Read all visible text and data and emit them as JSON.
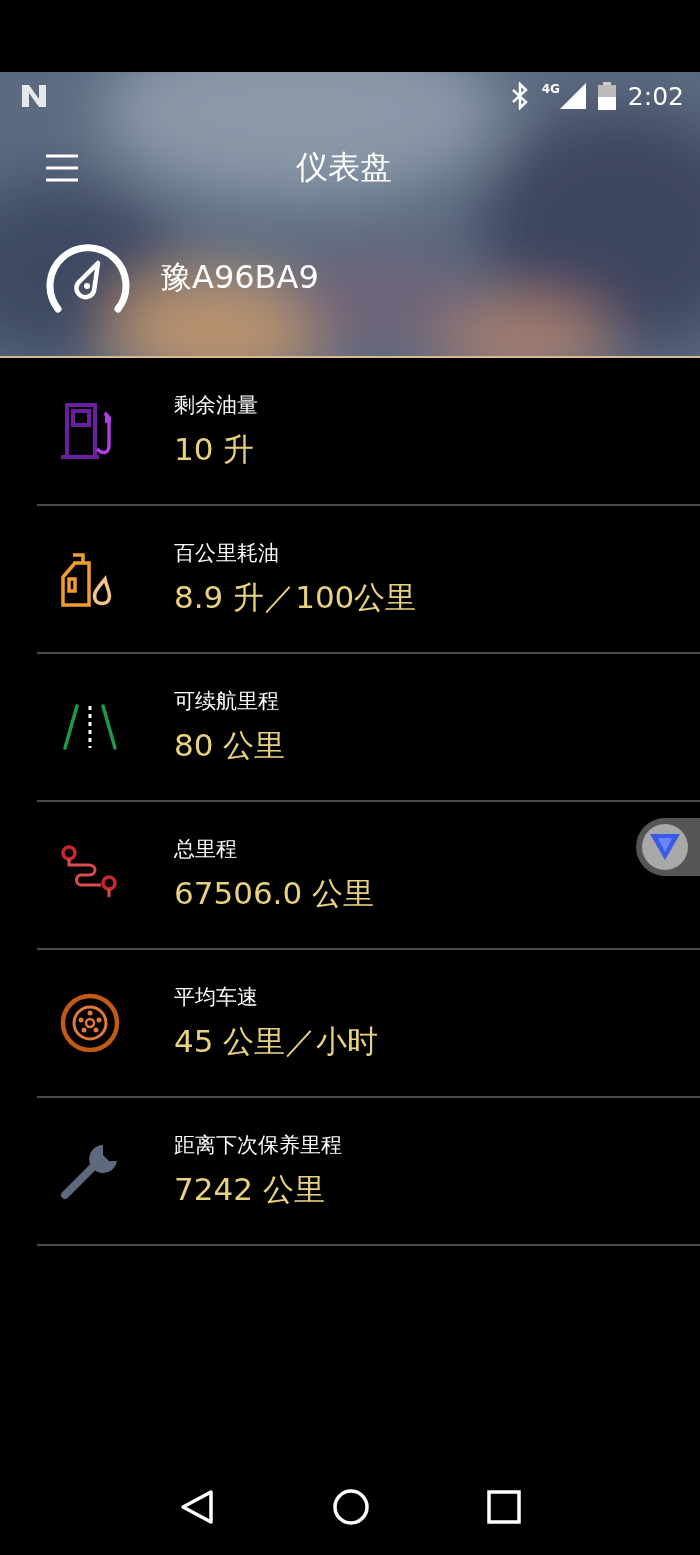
{
  "status_bar": {
    "network": "4G",
    "time": "2:02"
  },
  "app_bar": {
    "title": "仪表盘"
  },
  "vehicle": {
    "plate": "豫A96BA9"
  },
  "metrics": [
    {
      "label": "剩余油量",
      "value": "10 升"
    },
    {
      "label": "百公里耗油",
      "value": "8.9 升／100公里"
    },
    {
      "label": "可续航里程",
      "value": "80 公里"
    },
    {
      "label": "总里程",
      "value": "67506.0 公里"
    },
    {
      "label": "平均车速",
      "value": "45 公里／小时"
    },
    {
      "label": "距离下次保养里程",
      "value": "7242 公里"
    }
  ]
}
